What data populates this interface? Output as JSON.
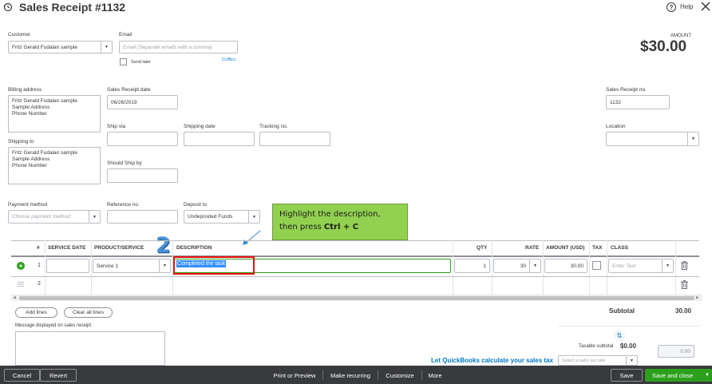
{
  "header": {
    "title": "Sales Receipt #1132",
    "help_label": "Help"
  },
  "customer": {
    "label": "Customer",
    "value": "Fritz Gerald Fudalan sample"
  },
  "email": {
    "label": "Email",
    "placeholder": "Email (Separate emails with a comma)",
    "send_later": "Send later",
    "cc_bcc": "Cc/Bcc"
  },
  "amount": {
    "label": "AMOUNT",
    "value": "$30.00"
  },
  "billing": {
    "label": "Billing address",
    "value": "Fritz Gerald Fudalan sample\nSample Address\nPhone Number"
  },
  "receipt_date": {
    "label": "Sales Receipt date",
    "value": "06/26/2019"
  },
  "receipt_no": {
    "label": "Sales Receipt no.",
    "value": "1132"
  },
  "ship_via": {
    "label": "Ship via"
  },
  "shipping_date": {
    "label": "Shipping date"
  },
  "tracking_no": {
    "label": "Tracking no."
  },
  "location": {
    "label": "Location"
  },
  "shipping_to": {
    "label": "Shipping to",
    "value": "Fritz Gerald Fudalan sample\nSample Address\nPhone Number"
  },
  "should_ship_by": {
    "label": "Should Ship by"
  },
  "payment_method": {
    "label": "Payment method",
    "placeholder": "Choose payment method"
  },
  "reference_no": {
    "label": "Reference no."
  },
  "deposit_to": {
    "label": "Deposit to",
    "value": "Undeposited Funds"
  },
  "callout": {
    "line1": "Highlight the description,",
    "line2_prefix": "then press ",
    "line2_keys": "Ctrl + C",
    "step_number": "2"
  },
  "table": {
    "headers": {
      "num": "#",
      "service_date": "SERVICE DATE",
      "product": "PRODUCT/SERVICE",
      "description": "DESCRIPTION",
      "qty": "QTY",
      "rate": "RATE",
      "amount": "AMOUNT (USD)",
      "tax": "TAX",
      "class": "CLASS"
    },
    "rows": [
      {
        "num": "1",
        "product": "Service 1",
        "description": "Completed the task",
        "qty": "1",
        "rate": "30",
        "amount": "30.00",
        "class_placeholder": "Enter Text"
      },
      {
        "num": "2"
      }
    ]
  },
  "actions": {
    "add_lines": "Add lines",
    "clear_lines": "Clear all lines"
  },
  "totals": {
    "subtotal_label": "Subtotal",
    "subtotal_value": "30.00",
    "taxable_subtotal_label": "Taxable subtotal",
    "taxable_subtotal_value": "$0.00",
    "tax_value": "0.00",
    "calc_tax_link": "Let QuickBooks calculate your sales tax",
    "tax_rate_placeholder": "Select a sales tax rate"
  },
  "message": {
    "label": "Message displayed on sales receipt"
  },
  "footer": {
    "cancel": "Cancel",
    "revert": "Revert",
    "print_preview": "Print or Preview",
    "make_recurring": "Make recurring",
    "customize": "Customize",
    "more": "More",
    "save": "Save",
    "save_close": "Save and close"
  },
  "colors": {
    "green": "#2ca01c",
    "highlight_red": "#e81010",
    "callout_bg": "#92d050",
    "link_blue": "#0077c5",
    "footer_bg": "#393a3d"
  }
}
